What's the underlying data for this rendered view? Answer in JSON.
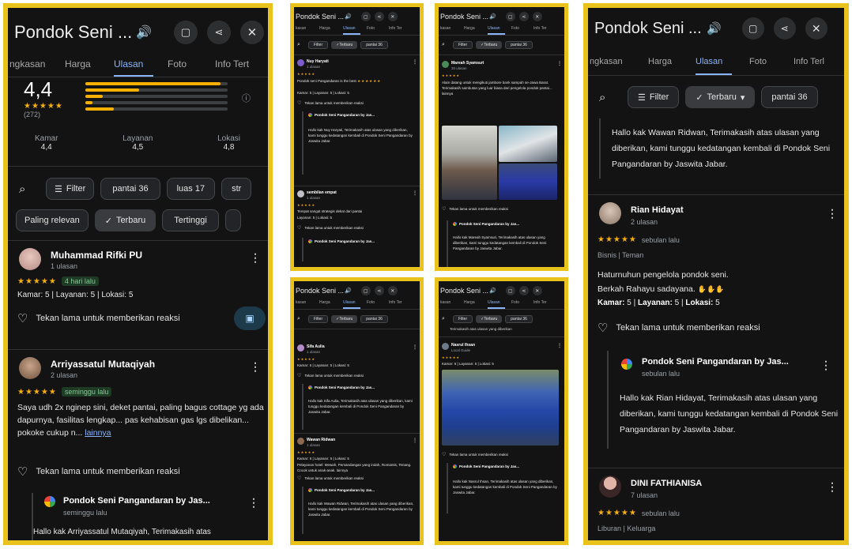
{
  "panel1": {
    "title": "Pondok Seni ...",
    "tabs": [
      "ngkasan",
      "Harga",
      "Ulasan",
      "Foto",
      "Info Tert"
    ],
    "rating": "4,4",
    "rating_count": "(272)",
    "rating_bars": [
      0.95,
      0.38,
      0.12,
      0.05,
      0.2
    ],
    "categories": [
      {
        "label": "Kamar",
        "value": "4,4"
      },
      {
        "label": "Layanan",
        "value": "4,5"
      },
      {
        "label": "Lokasi",
        "value": "4,8"
      }
    ],
    "filter_chips": [
      "Filter",
      "pantai 36",
      "luas 17",
      "str"
    ],
    "sort_chips": [
      "Paling relevan",
      "Terbaru",
      "Tertinggi"
    ],
    "reviews": [
      {
        "name": "Muhammad Rifki PU",
        "sub": "1 ulasan",
        "stars": "★★★★★",
        "time": "4 hari lalu",
        "scores": "Kamar: 5 | Layanan: 5 | Lokasi: 5",
        "react": "Tekan lama untuk memberikan reaksi"
      },
      {
        "name": "Arriyassatul Mutaqiyah",
        "sub": "2 ulasan",
        "stars": "★★★★★",
        "time": "seminggu lalu",
        "text": "Saya udh 2x nginep sini, deket pantai, paling bagus cottage yg ada dapurnya, fasilitas lengkap... pas kehabisan gas lgs dibelikan... pokoke cukup n...",
        "more": "lainnya",
        "react": "Tekan lama untuk memberikan reaksi"
      }
    ],
    "owner": {
      "name": "Pondok Seni Pangandaran by Jas...",
      "time": "seminggu lalu",
      "reply": "Hallo kak Arriyassatul Mutaqiyah, Terimakasih atas"
    }
  },
  "panel2": {
    "title": "Pondok Seni ...",
    "tabs": [
      "kasan",
      "Harga",
      "Ulasan",
      "Foto",
      "Info Ter"
    ],
    "chips": [
      "Filter",
      "Terbaru",
      "pantai 36"
    ],
    "reviews": [
      {
        "name": "Nuy Haryati",
        "sub": "1 ulasan",
        "stars": "★★★★★",
        "text": "Pondok seni Pangandaran is the best",
        "scores": "Kamar: 5 | Layanan: 5 | Lokasi: 5",
        "react": "Tekan lama untuk memberikan reaksi",
        "owner": "Pondok Seni Pangandaran by Jas...",
        "reply": "Hallo kak Nuy Haryati, Terimakasih atas ulasan yang diberikan, kami tunggu kedatangan kembali di Pondok Seni Pangandaran by Jaswita Jabar."
      },
      {
        "name": "sembilan empat",
        "sub": "1 ulasan",
        "stars": "★★★★★",
        "text": "Tempat sangat strategis dekat dari pantai",
        "scores": "Layanan: 5 | Lokasi: 5",
        "react": "Tekan lama untuk memberikan reaksi",
        "owner": "Pondok Seni Pangandaran by Jas..."
      }
    ]
  },
  "panel3": {
    "title": "Pondok Seni ...",
    "tabs": [
      "kasan",
      "Harga",
      "Ulasan",
      "Foto",
      "Info Ter"
    ],
    "chips": [
      "Filter",
      "Terbaru",
      "pantai 36"
    ],
    "review": {
      "name": "Mareah Syamsuri",
      "sub": "30 ulasan",
      "stars": "★★★★★",
      "text": "Alam datang untuk mengikuti jambore bank sampah se-Jawa Barat. Terimakasih sambutan yang luar biasa dari pengelola pondok pantai... lainnya",
      "react": "Tekan lama untuk memberikan reaksi",
      "owner": "Pondok Seni Pangandaran by Jas...",
      "reply": "Hallo kak Mareah Syamsuri, Terimakasih atas ulasan yang diberikan, kami tunggu kedatangan kembali di Pondok Seni Pangandaran by Jaswita Jabar."
    }
  },
  "panel4": {
    "title": "Pondok Seni ...",
    "tabs": [
      "kasan",
      "Harga",
      "Ulasan",
      "Foto",
      "Info Ter"
    ],
    "chips": [
      "Filter",
      "Terbaru",
      "pantai 36"
    ],
    "reviews": [
      {
        "name": "Sifa Aulia",
        "sub": "1 ulasan",
        "stars": "★★★★★",
        "scores": "Kamar: 5 | Layanan: 5 | Lokasi: 5",
        "react": "Tekan lama untuk memberikan reaksi",
        "owner": "Pondok Seni Pangandaran by Jas...",
        "reply": "Hallo kak Sifa Aulia, Terimakasih atas ulasan yang diberikan, kami tunggu kedatangan kembali di Pondok Seni Pangandaran by Jaswita Jabar."
      },
      {
        "name": "Wawan Ridwan",
        "sub": "1 ulasan",
        "stars": "★★★★★",
        "scores": "Kamar: 5 | Layanan: 5 | Lokasi: 5",
        "text": "Pelayanan hotel: Mewah, Pemandangan yang indah, Romantis, Tenang. Cocok untuk anak-anak. lainnya",
        "react": "Tekan lama untuk memberikan reaksi",
        "owner": "Pondok Seni Pangandaran by Jas...",
        "reply": "Hallo kak Wawan Ridwan, Terimakasih atas ulasan yang diberikan, kami tunggu kedatangan kembali di Pondok Seni Pangandaran by Jaswita Jabar."
      }
    ]
  },
  "panel5": {
    "title": "Pondok Seni ...",
    "tabs": [
      "kasan",
      "Harga",
      "Ulasan",
      "Foto",
      "Info Ter"
    ],
    "chips": [
      "Filter",
      "Terbaru",
      "pantai 36"
    ],
    "top_text": "Terimakasih atas ulasan yang diberikan",
    "review": {
      "name": "Nasrul Ihsan",
      "sub": "Local Guide",
      "stars": "★★★★★",
      "scores": "Kamar: 5 | Layanan: 5 | Lokasi: 5",
      "react": "Tekan lama untuk memberikan reaksi",
      "owner": "Pondok Seni Pangandaran by Jas...",
      "reply": "Hallo kak Nasrul Ihsan, Terimakasih atas ulasan yang diberikan, kami tunggu kedatangan kembali di Pondok Seni Pangandaran by Jaswita Jabar."
    }
  },
  "panel6": {
    "title": "Pondok Seni ...",
    "tabs": [
      "ngkasan",
      "Harga",
      "Ulasan",
      "Foto",
      "Info Terl"
    ],
    "chips": [
      "Filter",
      "Terbaru",
      "pantai 36"
    ],
    "top_reply": "Hallo kak Wawan Ridwan, Terimakasih atas ulasan yang diberikan, kami tunggu kedatangan kembali di Pondok Seni Pangandaran by Jaswita Jabar.",
    "review": {
      "name": "Rian Hidayat",
      "sub": "2 ulasan",
      "stars": "★★★★★",
      "time": "sebulan lalu",
      "trip": "Bisnis | Teman",
      "text1": "Haturnuhun pengelola pondok seni.",
      "text2": "Berkah Rahayu sadayana.",
      "scores_k": "Kamar:",
      "scores_kv": " 5 | ",
      "scores_l": "Layanan:",
      "scores_lv": " 5 | ",
      "scores_o": "Lokasi:",
      "scores_ov": " 5",
      "react": "Tekan lama untuk memberikan reaksi"
    },
    "owner": {
      "name": "Pondok Seni Pangandaran by Jas...",
      "time": "sebulan lalu",
      "reply": "Hallo kak Rian Hidayat, Terimakasih atas ulasan yang diberikan, kami tunggu kedatangan kembali di Pondok Seni Pangandaran by Jaswita Jabar."
    },
    "review2": {
      "name": "DINI FATHIANISA",
      "sub": "7 ulasan",
      "stars": "★★★★★",
      "time": "sebulan lalu",
      "trip": "Liburan | Keluarga"
    }
  },
  "colors": {
    "frame": "#e9c21b",
    "bg": "#131314",
    "accent": "#8ab4f8",
    "star": "#f6b100"
  }
}
